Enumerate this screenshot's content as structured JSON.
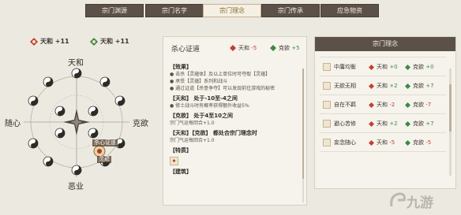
{
  "tabs": [
    {
      "label": "宗门渊源",
      "active": false
    },
    {
      "label": "宗门名字",
      "active": false
    },
    {
      "label": "宗门理念",
      "active": true
    },
    {
      "label": "宗门传承",
      "active": false
    },
    {
      "label": "应急物资",
      "active": false
    }
  ],
  "diagram": {
    "badges": [
      {
        "text": "天和 +11"
      },
      {
        "text": "天和 +11"
      }
    ],
    "axes": {
      "top": "天和",
      "bottom": "恶业",
      "left": "随心",
      "right": "克欲"
    },
    "marker_labels": [
      "杀心证道",
      "灵蕴"
    ]
  },
  "detail": {
    "title": "杀心证道",
    "stat1": {
      "label": "天和",
      "value": "-5"
    },
    "stat2": {
      "label": "克欲",
      "value": "+5"
    },
    "sections": [
      {
        "head": "【效果】",
        "lines": [
          "● 击杀【灵蕴体】及以上单位时可夺取【灵蕴】",
          "● 承受【灵蕴】系列和战斗",
          "● 通过证道【杀意争夺】可以发现前往游戏的秘密"
        ]
      },
      {
        "head": "【天和】 处于-10至-4之间",
        "lines": [
          "● 修士战斗时有概率获得额外收益5%"
        ]
      },
      {
        "head": "【克欲】 处于4至10之间",
        "lines": [
          "宗门气运每回合+1.0"
        ]
      },
      {
        "head": "【天和】【克欲】 都处合宗门理念时",
        "lines": [
          "宗门气运每回合+1.0"
        ]
      },
      {
        "head": "【特质】",
        "lines": []
      },
      {
        "head": "【建筑】",
        "lines": []
      }
    ]
  },
  "panel": {
    "title": "宗门理念",
    "rows": [
      {
        "name": "中庸均衡",
        "v1_label": "天和",
        "v1": "+0",
        "v2_label": "克欲",
        "v2": "+0"
      },
      {
        "name": "无欲无相",
        "v1_label": "天和",
        "v1": "+2",
        "v2_label": "克欲",
        "v2": "+7"
      },
      {
        "name": "自在不羁",
        "v1_label": "天和",
        "v1": "-2",
        "v2_label": "克欲",
        "v2": "-7"
      },
      {
        "name": "避心苦修",
        "v1_label": "天和",
        "v1": "+2",
        "v2_label": "克欲",
        "v2": "+7"
      },
      {
        "name": "妄念随心",
        "v1_label": "天和",
        "v1": "-5",
        "v2_label": "克欲",
        "v2": "-5"
      }
    ]
  },
  "watermark": "九游",
  "colors": {
    "positive": "#3b8a45",
    "negative": "#c23a2c",
    "header": "#5b5148",
    "accent": "#8c6b2e"
  }
}
